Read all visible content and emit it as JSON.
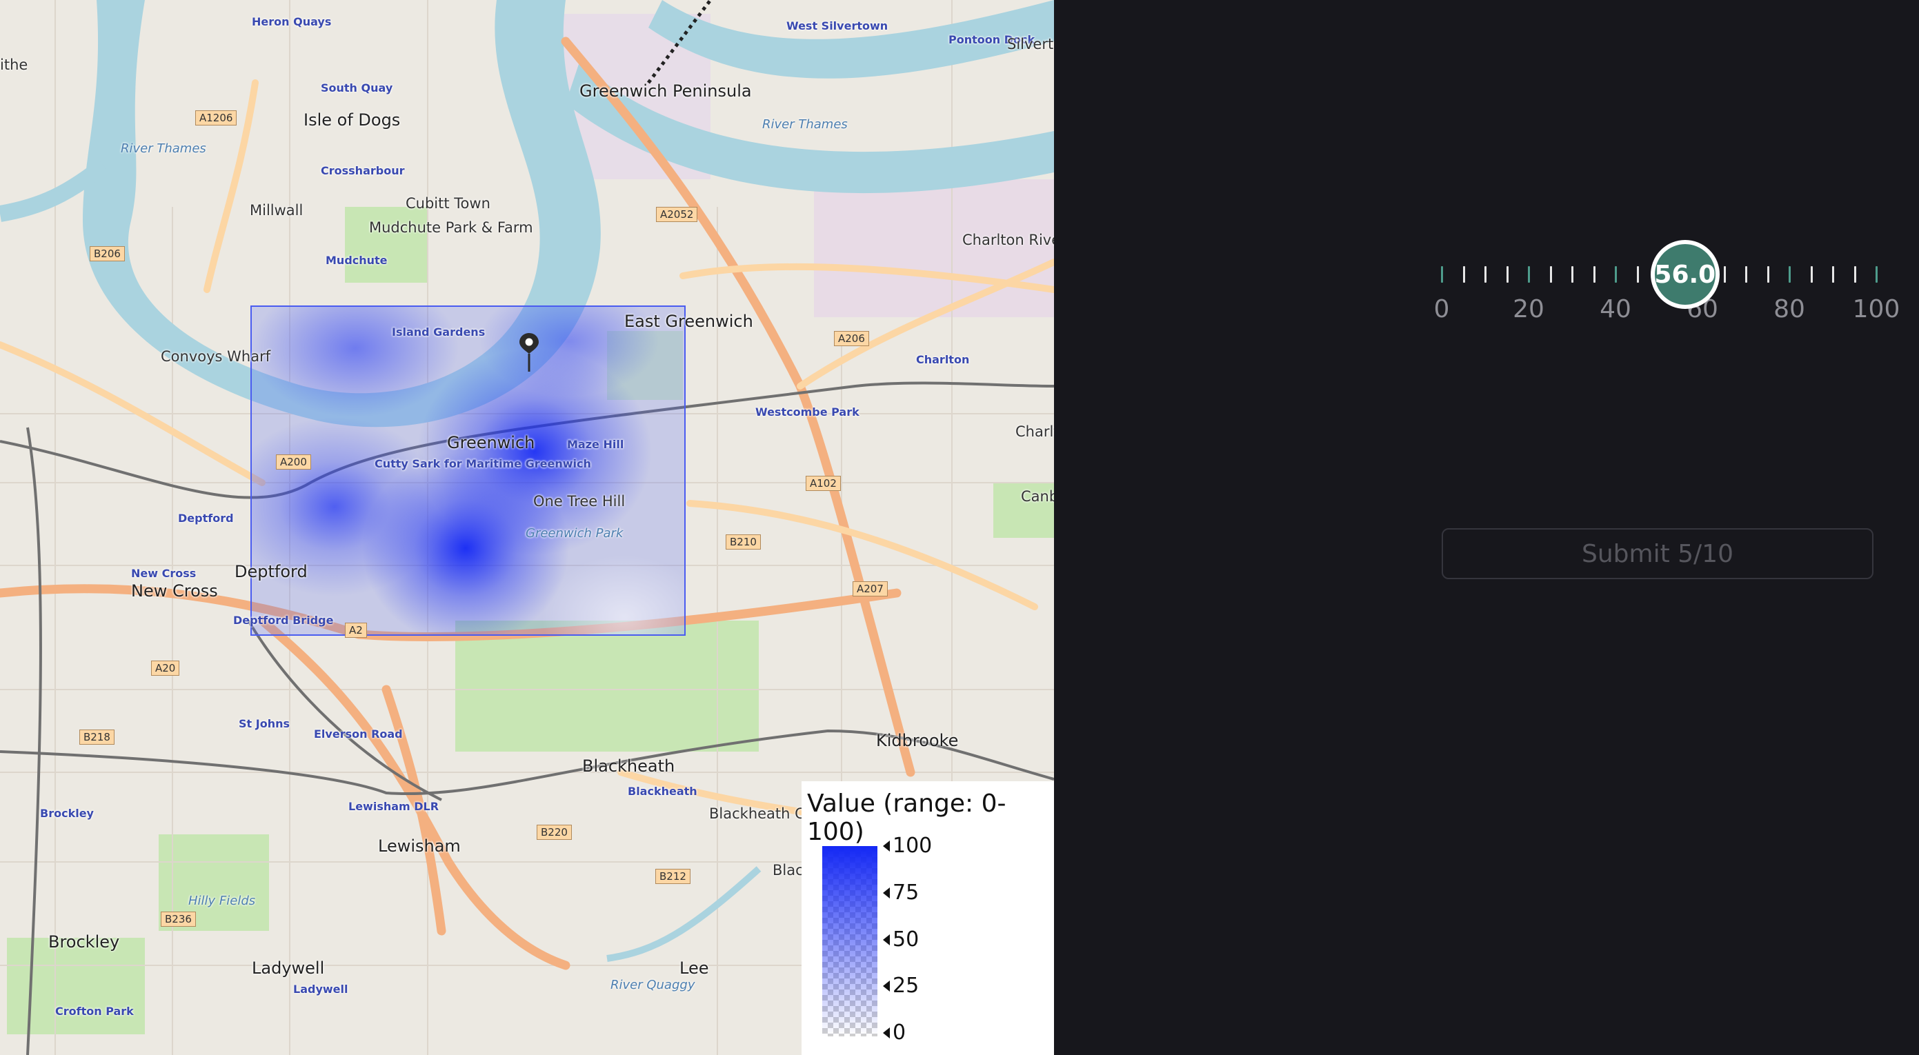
{
  "map": {
    "places": [
      {
        "name": "Isle of Dogs",
        "cls": "big"
      },
      {
        "name": "Greenwich Peninsula",
        "cls": "big"
      },
      {
        "name": "West Silvertown",
        "cls": "blue"
      },
      {
        "name": "Pontoon Dock",
        "cls": "blue"
      },
      {
        "name": "Silverto",
        "cls": ""
      },
      {
        "name": "South Quay",
        "cls": "blue"
      },
      {
        "name": "Heron Quays",
        "cls": "blue"
      },
      {
        "name": "Crossharbour",
        "cls": "blue"
      },
      {
        "name": "Cubitt Town",
        "cls": ""
      },
      {
        "name": "Millwall",
        "cls": ""
      },
      {
        "name": "Mudchute",
        "cls": "blue"
      },
      {
        "name": "Mudchute Park & Farm",
        "cls": ""
      },
      {
        "name": "Charlton Rive",
        "cls": ""
      },
      {
        "name": "East Greenwich",
        "cls": "big"
      },
      {
        "name": "Island Gardens",
        "cls": "blue"
      },
      {
        "name": "Convoys Wharf",
        "cls": ""
      },
      {
        "name": "Greenwich",
        "cls": "big"
      },
      {
        "name": "Cutty Sark for Maritime Greenwich",
        "cls": "blue"
      },
      {
        "name": "Maze Hill",
        "cls": "blue"
      },
      {
        "name": "One Tree Hill",
        "cls": ""
      },
      {
        "name": "Greenwich Park",
        "cls": "water"
      },
      {
        "name": "Westcombe Park",
        "cls": "blue"
      },
      {
        "name": "Charlton",
        "cls": "blue"
      },
      {
        "name": "Charlton",
        "cls": ""
      },
      {
        "name": "Deptford",
        "cls": "blue"
      },
      {
        "name": "Deptford",
        "cls": "big"
      },
      {
        "name": "New Cross",
        "cls": "blue"
      },
      {
        "name": "New Cross",
        "cls": "big"
      },
      {
        "name": "Deptford Bridge",
        "cls": "blue"
      },
      {
        "name": "Kidbrooke",
        "cls": "big"
      },
      {
        "name": "Blackheath",
        "cls": "big"
      },
      {
        "name": "Blackheath",
        "cls": "blue"
      },
      {
        "name": "Blackheath Cator Estate",
        "cls": ""
      },
      {
        "name": "Blackhea Park",
        "cls": ""
      },
      {
        "name": "St Johns",
        "cls": "blue"
      },
      {
        "name": "Elverson Road",
        "cls": "blue"
      },
      {
        "name": "Lewisham DLR",
        "cls": "blue"
      },
      {
        "name": "Lewisham",
        "cls": "big"
      },
      {
        "name": "Brockley",
        "cls": "blue"
      },
      {
        "name": "Brockley",
        "cls": "big"
      },
      {
        "name": "Hilly Fields",
        "cls": "water"
      },
      {
        "name": "Ladywell",
        "cls": "big"
      },
      {
        "name": "Ladywell",
        "cls": "blue"
      },
      {
        "name": "Lee",
        "cls": "big"
      },
      {
        "name": "Crofton Park",
        "cls": "blue"
      },
      {
        "name": "River Thames",
        "cls": "water"
      },
      {
        "name": "River Thames",
        "cls": "water"
      },
      {
        "name": "River Quaggy",
        "cls": "water"
      },
      {
        "name": "ithe",
        "cls": ""
      },
      {
        "name": "Canber",
        "cls": ""
      }
    ],
    "roads": [
      "A1206",
      "A2052",
      "A206",
      "A102",
      "B206",
      "A200",
      "A2",
      "B210",
      "A207",
      "A20",
      "B218",
      "B220",
      "B212",
      "B236",
      "A102"
    ]
  },
  "legend": {
    "title": "Value (range: 0-100)",
    "ticks": [
      "100",
      "75",
      "50",
      "25",
      "0"
    ]
  },
  "slider": {
    "value": 56.0,
    "value_label": "56.0",
    "min": 0,
    "max": 100,
    "labels": [
      "0",
      "20",
      "40",
      "60",
      "80",
      "100"
    ]
  },
  "submit": {
    "label": "Submit 5/10"
  }
}
